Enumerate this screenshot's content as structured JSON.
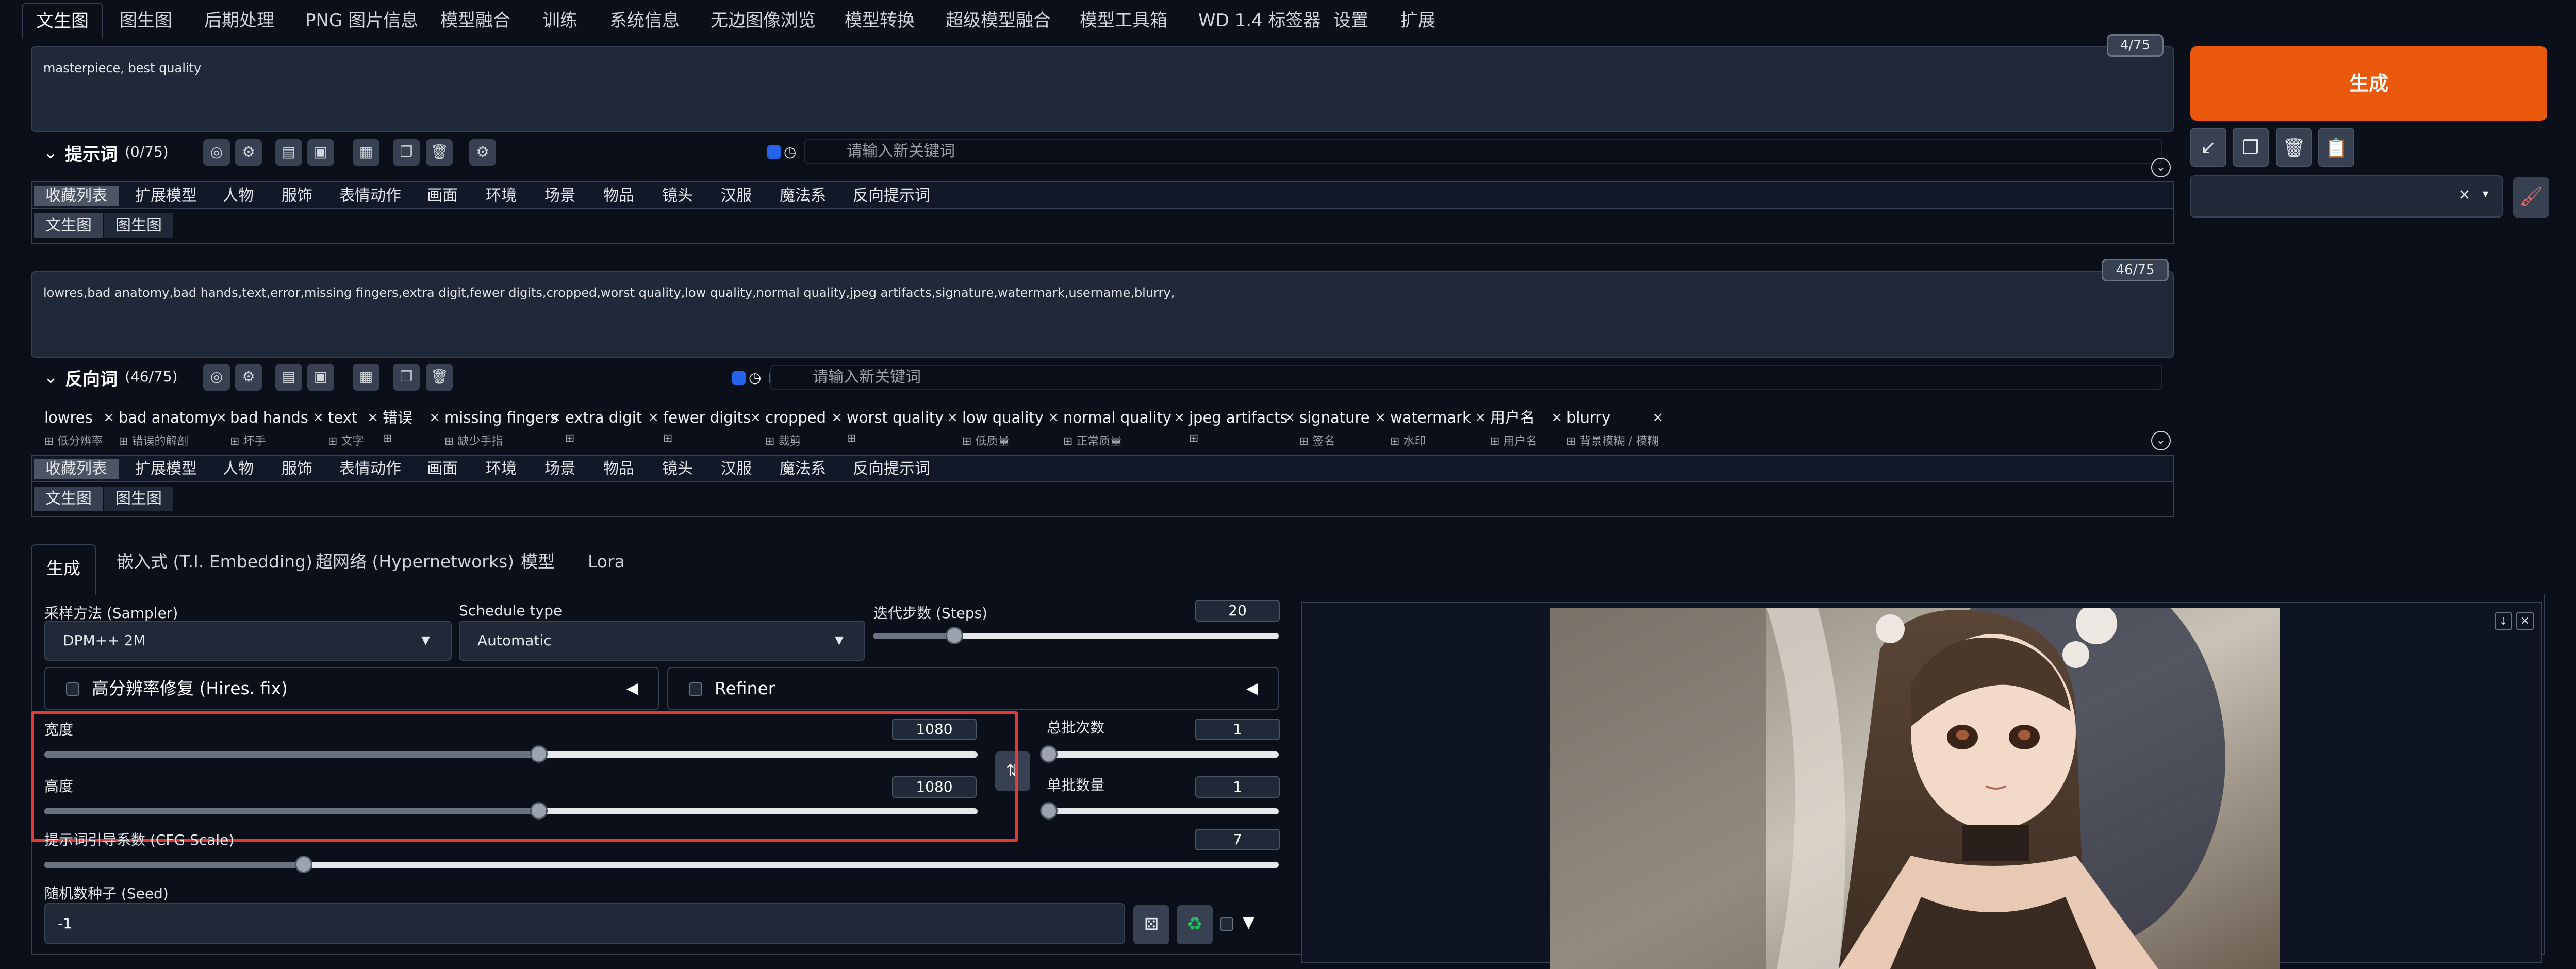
{
  "tabs": [
    "文生图",
    "图生图",
    "后期处理",
    "PNG 图片信息",
    "模型融合",
    "训练",
    "系统信息",
    "无边图像浏览",
    "模型转换",
    "超级模型融合",
    "模型工具箱",
    "WD 1.4 标签器",
    "设置",
    "扩展"
  ],
  "prompt": {
    "text": "masterpiece, best quality",
    "counter": "4/75",
    "title": "提示词",
    "count": "(0/75)",
    "keyword_placeholder": "请输入新关键词"
  },
  "negative": {
    "text": "lowres,bad anatomy,bad hands,text,error,missing fingers,extra digit,fewer digits,cropped,worst quality,low quality,normal quality,jpeg artifacts,signature,watermark,username,blurry,",
    "counter": "46/75",
    "title": "反向词",
    "count": "(46/75)",
    "keyword_placeholder": "请输入新关键词"
  },
  "categories": [
    "收藏列表",
    "扩展模型",
    "人物",
    "服饰",
    "表情动作",
    "画面",
    "环境",
    "场景",
    "物品",
    "镜头",
    "汉服",
    "魔法系",
    "反向提示词"
  ],
  "subtabs": [
    "文生图",
    "图生图"
  ],
  "chips": [
    {
      "en": "lowres",
      "zh": "低分辨率"
    },
    {
      "en": "bad anatomy",
      "zh": "错误的解剖"
    },
    {
      "en": "bad hands",
      "zh": "坏手"
    },
    {
      "en": "text",
      "zh": "文字"
    },
    {
      "en": "错误",
      "zh": ""
    },
    {
      "en": "missing fingers",
      "zh": "缺少手指"
    },
    {
      "en": "extra digit",
      "zh": ""
    },
    {
      "en": "fewer digits",
      "zh": ""
    },
    {
      "en": "cropped",
      "zh": "裁剪"
    },
    {
      "en": "worst quality",
      "zh": ""
    },
    {
      "en": "low quality",
      "zh": "低质量"
    },
    {
      "en": "normal quality",
      "zh": "正常质量"
    },
    {
      "en": "jpeg artifacts",
      "zh": ""
    },
    {
      "en": "signature",
      "zh": "签名"
    },
    {
      "en": "watermark",
      "zh": "水印"
    },
    {
      "en": "用户名",
      "zh": "用户名"
    },
    {
      "en": "blurry",
      "zh": "背景模糊 / 模糊"
    }
  ],
  "generate_label": "生成",
  "panel_tabs": [
    "生成",
    "嵌入式 (T.I. Embedding)",
    "超网络 (Hypernetworks)",
    "模型",
    "Lora"
  ],
  "sampler": {
    "label": "采样方法 (Sampler)",
    "value": "DPM++ 2M"
  },
  "schedule": {
    "label": "Schedule type",
    "value": "Automatic"
  },
  "steps": {
    "label": "迭代步数 (Steps)",
    "value": "20",
    "level": 0.2
  },
  "hires": {
    "label": "高分辨率修复 (Hires. fix)"
  },
  "refiner": {
    "label": "Refiner"
  },
  "width": {
    "label": "宽度",
    "value": "1080",
    "level": 0.53
  },
  "height": {
    "label": "高度",
    "value": "1080",
    "level": 0.53
  },
  "batch_count": {
    "label": "总批次数",
    "value": "1",
    "level": 0.0
  },
  "batch_size": {
    "label": "单批数量",
    "value": "1",
    "level": 0.0
  },
  "cfg": {
    "label": "提示词引导系数 (CFG Scale)",
    "value": "7",
    "level": 0.21
  },
  "seed": {
    "label": "随机数种子 (Seed)",
    "value": "-1"
  },
  "colors": {
    "accent": "#ea580c",
    "highlight": "#e53935",
    "checkbox": "#2563eb"
  }
}
